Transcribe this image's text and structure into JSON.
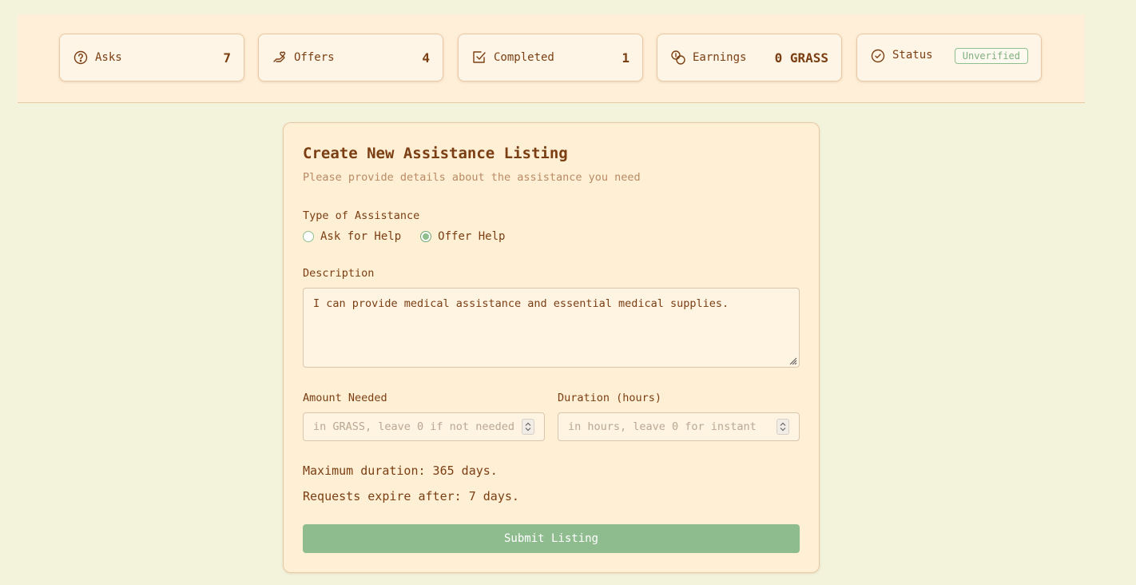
{
  "stats": {
    "asks": {
      "label": "Asks",
      "value": "7",
      "icon": "question-circle-icon"
    },
    "offers": {
      "label": "Offers",
      "value": "4",
      "icon": "hand-heart-icon"
    },
    "completed": {
      "label": "Completed",
      "value": "1",
      "icon": "check-square-icon"
    },
    "earnings": {
      "label": "Earnings",
      "value": "0 GRASS",
      "icon": "coins-icon"
    },
    "status": {
      "label": "Status",
      "badge": "Unverified",
      "icon": "check-circle-icon"
    }
  },
  "form": {
    "title": "Create New Assistance Listing",
    "subtitle": "Please provide details about the assistance you need",
    "type_label": "Type of Assistance",
    "type_options": [
      {
        "label": "Ask for Help",
        "selected": false
      },
      {
        "label": "Offer Help",
        "selected": true
      }
    ],
    "description_label": "Description",
    "description_value": "I can provide medical assistance and essential medical supplies.",
    "amount_label": "Amount Needed",
    "amount_placeholder": "in GRASS, leave 0 if not needed",
    "duration_label": "Duration (hours)",
    "duration_placeholder": "in hours, leave 0 for instant",
    "max_duration_text": "Maximum duration: 365 days.",
    "expire_text": "Requests expire after: 7 days.",
    "submit_label": "Submit Listing"
  },
  "colors": {
    "page_bg": "#f3f3dc",
    "header_bg": "#ffefd8",
    "card_bg": "#ffefd5",
    "text": "#7a3e12",
    "accent_green": "#8fbc8f"
  }
}
